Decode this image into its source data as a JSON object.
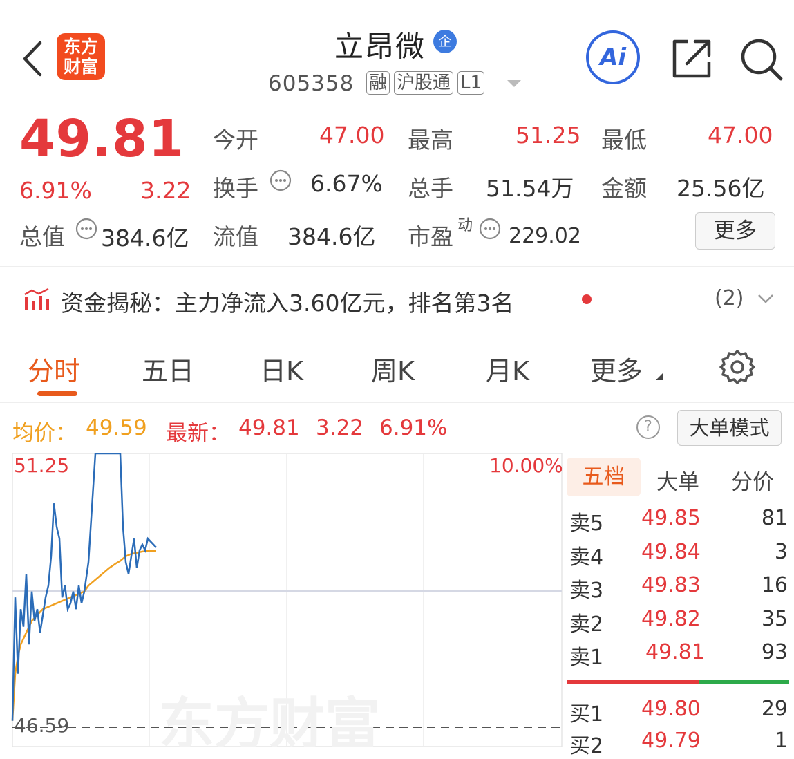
{
  "header": {
    "logo_line1": "东方",
    "logo_line2": "财富",
    "stock_name": "立昂微",
    "enterprise_badge": "企",
    "stock_code": "605358",
    "tags": [
      "融",
      "沪股通",
      "L1"
    ],
    "ai_label": "Ai"
  },
  "quote": {
    "price": "49.81",
    "change_pct": "6.91%",
    "change": "3.22",
    "open_label": "今开",
    "open": "47.00",
    "high_label": "最高",
    "high": "51.25",
    "low_label": "最低",
    "low": "47.00",
    "turnover_label": "换手",
    "turnover": "6.67%",
    "volume_label": "总手",
    "volume": "51.54万",
    "amount_label": "金额",
    "amount": "25.56亿",
    "mktcap_label": "总值",
    "mktcap": "384.6亿",
    "float_label": "流值",
    "float": "384.6亿",
    "pe_label": "市盈",
    "pe_sup": "动",
    "pe": "229.02",
    "more_label": "更多"
  },
  "fund": {
    "text": "资金揭秘：主力净流入3.60亿元，排名第3名",
    "count": "(2)"
  },
  "tabs": [
    "分时",
    "五日",
    "日K",
    "周K",
    "月K",
    "更多"
  ],
  "info_bar": {
    "avg_label": "均价：",
    "avg": "49.59",
    "latest_label": "最新：",
    "latest": "49.81",
    "change": "3.22",
    "change_pct": "6.91%",
    "help": "?",
    "big_order_mode": "大单模式"
  },
  "chart_data": {
    "type": "line",
    "y_top_label": "51.25",
    "y_bottom_label": "46.59",
    "right_top_label": "10.00%",
    "watermark": "东方财富",
    "ylim": [
      46.59,
      51.25
    ],
    "series": [
      {
        "color": "#2b6cb8",
        "x": [
          0,
          2,
          4,
          6,
          8,
          10,
          12,
          14,
          16,
          18,
          20,
          22,
          24,
          26,
          28,
          30,
          32,
          34,
          36,
          38,
          40,
          42,
          44,
          46,
          48,
          50,
          52,
          55,
          60,
          65,
          70,
          75,
          78,
          80,
          82,
          84,
          86,
          88,
          90,
          92,
          94,
          96,
          98,
          100,
          102,
          104
        ],
        "y": [
          46.7,
          48.8,
          47.5,
          48.6,
          48.3,
          49.2,
          48.0,
          48.9,
          48.4,
          48.6,
          48.2,
          48.5,
          48.8,
          49.0,
          49.5,
          50.4,
          50.0,
          49.8,
          48.8,
          49.0,
          48.6,
          48.7,
          48.9,
          48.6,
          49.0,
          48.7,
          48.9,
          49.4,
          51.25,
          51.25,
          51.25,
          51.25,
          51.25,
          50.0,
          49.4,
          49.2,
          49.5,
          49.8,
          49.3,
          49.6,
          49.7,
          49.6,
          49.8,
          49.75,
          49.7,
          49.65
        ]
      },
      {
        "color": "#f0a020",
        "x": [
          0,
          2,
          4,
          6,
          8,
          10,
          12,
          14,
          16,
          18,
          20,
          22,
          24,
          26,
          28,
          30,
          32,
          34,
          36,
          38,
          40,
          42,
          44,
          46,
          48,
          50,
          52,
          55,
          60,
          65,
          70,
          75,
          78,
          80,
          82,
          84,
          86,
          88,
          90,
          92,
          94,
          96,
          98,
          100,
          102,
          104
        ],
        "y": [
          46.7,
          47.5,
          47.8,
          48.0,
          48.1,
          48.2,
          48.3,
          48.4,
          48.45,
          48.5,
          48.55,
          48.6,
          48.62,
          48.64,
          48.66,
          48.68,
          48.7,
          48.72,
          48.74,
          48.76,
          48.78,
          48.8,
          48.82,
          48.84,
          48.86,
          48.88,
          48.9,
          49.0,
          49.1,
          49.2,
          49.3,
          49.38,
          49.42,
          49.46,
          49.5,
          49.52,
          49.54,
          49.55,
          49.56,
          49.57,
          49.58,
          49.585,
          49.59,
          49.59,
          49.59,
          49.59
        ]
      }
    ]
  },
  "orderbook": {
    "tabs": [
      "五档",
      "大单",
      "分价"
    ],
    "asks": [
      {
        "label": "卖5",
        "price": "49.85",
        "volume": "81"
      },
      {
        "label": "卖4",
        "price": "49.84",
        "volume": "3"
      },
      {
        "label": "卖3",
        "price": "49.83",
        "volume": "16"
      },
      {
        "label": "卖2",
        "price": "49.82",
        "volume": "35"
      },
      {
        "label": "卖1",
        "price": "49.81",
        "volume": "93"
      }
    ],
    "bids": [
      {
        "label": "买1",
        "price": "49.80",
        "volume": "29"
      },
      {
        "label": "买2",
        "price": "49.79",
        "volume": "1"
      }
    ],
    "ask_color": "#e4393c",
    "bid_color": "#2daa4a"
  }
}
